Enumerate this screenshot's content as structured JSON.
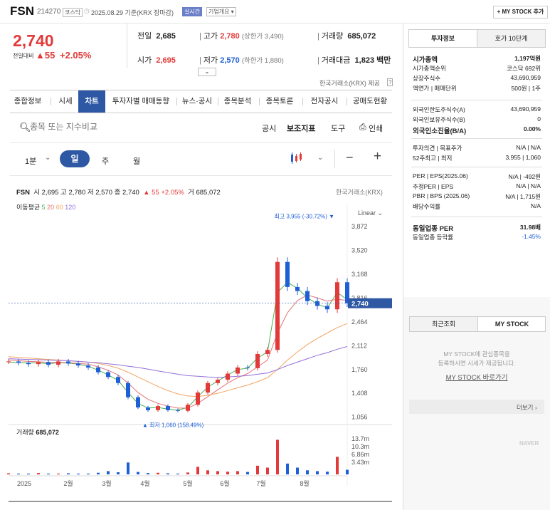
{
  "header": {
    "name": "FSN",
    "code": "214270",
    "market_tag": "코스닥",
    "date_text": "2025.08.29 기준(KRX 장마감)",
    "realtime_tag": "실시간",
    "company_tag": "기업개요",
    "mystock_btn": "+ MY STOCK 추가"
  },
  "quote": {
    "price": "2,740",
    "change_label": "전일대비",
    "change": "▲55",
    "change_pct": "+2.05%",
    "prev_label": "전일",
    "prev": "2,685",
    "high_label": "고가",
    "high": "2,780",
    "upper_limit": "(상한가 3,490)",
    "volume_label": "거래량",
    "volume": "685,072",
    "open_label": "시가",
    "open": "2,695",
    "low_label": "저가",
    "low": "2,570",
    "lower_limit": "(하한가 1,880)",
    "amount_label": "거래대금",
    "amount": "1,823 백만",
    "source": "한국거래소(KRX) 제공"
  },
  "tabs": [
    "종합정보",
    "시세",
    "차트",
    "투자자별 매매동향",
    "뉴스·공시",
    "종목분석",
    "종목토론",
    "전자공시",
    "공매도현황"
  ],
  "search": {
    "placeholder": "종목 또는 지수비교",
    "actions": [
      "공시",
      "보조지표",
      "도구",
      "인쇄"
    ]
  },
  "controls": {
    "interval": "1분",
    "periods": [
      "일",
      "주",
      "월"
    ]
  },
  "chart_info": {
    "ticker": "FSN",
    "ohlc_text": "시 2,695  고 2,780  저 2,570  종 2,740",
    "change_text": "▲ 55  +2.05%",
    "volume_text": "거 685,072",
    "source": "한국거래소(KRX)",
    "ma_label": "이동평균",
    "ma_periods": [
      "5",
      "20",
      "60",
      "120"
    ],
    "scale": "Linear",
    "high_annot": "최고 3,955 (-30.72%)",
    "low_annot": "최저 1,060 (158.49%)",
    "volume_label": "거래량",
    "volume_value": "685,072",
    "current_price_tag": "2,740"
  },
  "chart_data": {
    "type": "line",
    "x": [
      "2025-01-02",
      "2025-01-09",
      "2025-01-16",
      "2025-01-23",
      "2025-01-31",
      "2025-02-07",
      "2025-02-14",
      "2025-02-21",
      "2025-02-28",
      "2025-03-07",
      "2025-03-14",
      "2025-03-21",
      "2025-03-28",
      "2025-04-04",
      "2025-04-11",
      "2025-04-18",
      "2025-04-25",
      "2025-05-02",
      "2025-05-09",
      "2025-05-16",
      "2025-05-23",
      "2025-05-30",
      "2025-06-05",
      "2025-06-13",
      "2025-06-20",
      "2025-06-27",
      "2025-07-04",
      "2025-07-11",
      "2025-07-18",
      "2025-07-25",
      "2025-08-01",
      "2025-08-08",
      "2025-08-14",
      "2025-08-22",
      "2025-08-29"
    ],
    "series": [
      {
        "name": "close",
        "values": [
          1880,
          1860,
          1840,
          1870,
          1830,
          1880,
          1850,
          1820,
          1790,
          1720,
          1650,
          1560,
          1350,
          1200,
          1160,
          1220,
          1160,
          1150,
          1240,
          1420,
          1560,
          1610,
          1700,
          1790,
          1780,
          1990,
          2050,
          3350,
          2980,
          2920,
          2770,
          2700,
          2650,
          3050,
          2740
        ]
      },
      {
        "name": "5",
        "values": [
          1870,
          1865,
          1855,
          1860,
          1845,
          1860,
          1855,
          1840,
          1810,
          1750,
          1680,
          1600,
          1420,
          1260,
          1190,
          1200,
          1175,
          1160,
          1200,
          1360,
          1500,
          1590,
          1680,
          1760,
          1780,
          1930,
          2020,
          2900,
          3050,
          2960,
          2820,
          2730,
          2670,
          2900,
          2790
        ]
      },
      {
        "name": "20",
        "values": [
          1900,
          1890,
          1880,
          1875,
          1865,
          1865,
          1860,
          1850,
          1840,
          1800,
          1750,
          1680,
          1560,
          1420,
          1320,
          1260,
          1220,
          1190,
          1190,
          1260,
          1360,
          1460,
          1560,
          1640,
          1700,
          1800,
          1900,
          2300,
          2600,
          2780,
          2860,
          2820,
          2770,
          2800,
          2780
        ]
      },
      {
        "name": "60",
        "values": [
          1950,
          1940,
          1930,
          1920,
          1910,
          1900,
          1890,
          1880,
          1870,
          1850,
          1820,
          1780,
          1720,
          1650,
          1580,
          1510,
          1450,
          1400,
          1370,
          1360,
          1380,
          1410,
          1450,
          1490,
          1530,
          1580,
          1640,
          1760,
          1900,
          2020,
          2130,
          2220,
          2300,
          2380,
          2440
        ]
      },
      {
        "name": "120",
        "values": [
          1920,
          1915,
          1910,
          1905,
          1900,
          1895,
          1890,
          1880,
          1870,
          1860,
          1845,
          1830,
          1810,
          1790,
          1765,
          1740,
          1715,
          1690,
          1670,
          1660,
          1650,
          1645,
          1650,
          1660,
          1670,
          1690,
          1710,
          1760,
          1820,
          1870,
          1920,
          1970,
          2010,
          2060,
          2100
        ]
      }
    ],
    "volume": [
      0.4,
      0.3,
      0.3,
      0.5,
      0.3,
      0.3,
      0.4,
      0.3,
      0.3,
      0.6,
      1.2,
      0.8,
      4.4,
      0.9,
      0.5,
      0.6,
      0.4,
      0.3,
      0.7,
      2.8,
      1.5,
      1.2,
      1.0,
      1.2,
      0.9,
      3.2,
      2.5,
      12.8,
      4.0,
      2.5,
      1.5,
      1.2,
      1.0,
      6.5,
      1.7
    ],
    "y_ticks": [
      "3,872",
      "3,520",
      "3,168",
      "2,816",
      "2,464",
      "2,112",
      "1,760",
      "1,408",
      "1,056"
    ],
    "ylim": [
      1000,
      4000
    ],
    "volume_ticks": [
      "13.7m",
      "10.3m",
      "6.86m",
      "3.43m"
    ],
    "x_ticks": [
      "2025",
      "2월",
      "3월",
      "4월",
      "5월",
      "6월",
      "7월",
      "8월"
    ],
    "colors": {
      "5": "#4caf50",
      "20": "#e57373",
      "60": "#f4a460",
      "120": "#9370db",
      "up": "#e23a3a",
      "down": "#1e5fd8"
    }
  },
  "invest_info": {
    "tabs": [
      "투자정보",
      "호가 10단계"
    ],
    "rows": [
      {
        "k": "시가총액",
        "v": "1,197억원",
        "bold": true
      },
      {
        "k": "시가총액순위",
        "v": "코스닥 692위"
      },
      {
        "k": "상장주식수",
        "v": "43,690,959"
      },
      {
        "k": "액면가 | 매매단위",
        "v": "500원 | 1주"
      },
      {
        "k": "외국인한도주식수(A)",
        "v": "43,690,959"
      },
      {
        "k": "외국인보유주식수(B)",
        "v": "0"
      },
      {
        "k": "외국인소진율(B/A)",
        "v": "0.00%",
        "bold": true
      },
      {
        "k": "투자의견 | 목표주가",
        "v": "N/A | N/A"
      },
      {
        "k": "52주최고 | 최저",
        "v": "3,955 | 1,060"
      },
      {
        "k": "PER | EPS(2025.06)",
        "v": "N/A | -492원"
      },
      {
        "k": "추정PER | EPS",
        "v": "N/A | N/A"
      },
      {
        "k": "PBR | BPS (2025.06)",
        "v": "N/A | 1,715원"
      },
      {
        "k": "배당수익률",
        "v": "N/A"
      },
      {
        "k": "동일업종 PER",
        "v": "31.98배",
        "bold": true
      },
      {
        "k": "동일업종 등락률",
        "v": "-1.45%"
      }
    ]
  },
  "recent": {
    "tabs": [
      "최근조회",
      "MY STOCK"
    ],
    "msg1": "MY STOCK에 관심종목을",
    "msg2": "등록하시면 시세가 제공됩니다.",
    "link": "MY STOCK 바로가기",
    "more": "더보기",
    "brand": "NAVER"
  }
}
